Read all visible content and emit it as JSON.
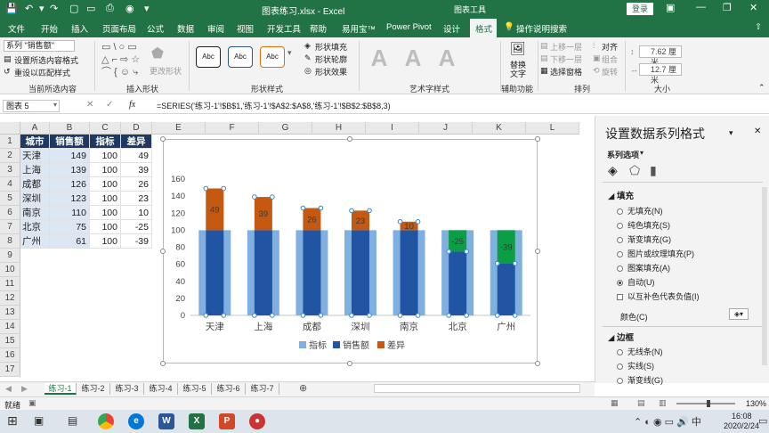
{
  "titlebar": {
    "title": "图表练习.xlsx - Excel",
    "context_tools": "图表工具",
    "login": "登录"
  },
  "tabs": [
    "文件",
    "开始",
    "插入",
    "页面布局",
    "公式",
    "数据",
    "审阅",
    "视图",
    "开发工具",
    "帮助",
    "易用宝™",
    "Power Pivot",
    "设计",
    "格式"
  ],
  "search": "操作说明搜索",
  "ribbon": {
    "current_selection": {
      "dropdown": "系列 \"销售额\"",
      "format_selection": "设置所选内容格式",
      "reset_match": "重设以匹配样式",
      "label": "当前所选内容"
    },
    "insert_shapes": {
      "change_shape": "更改形状",
      "label": "插入形状"
    },
    "shape_styles": {
      "sample": "Abc",
      "fill": "形状填充",
      "outline": "形状轮廓",
      "effects": "形状效果",
      "label": "形状样式"
    },
    "wordart": {
      "sample": "A",
      "label": "艺术字样式"
    },
    "accessibility": {
      "alt_text": "替换文字",
      "label": "辅助功能"
    },
    "arrange": {
      "bring_forward": "上移一层",
      "send_backward": "下移一层",
      "selection_pane": "选择窗格",
      "align": "对齐",
      "group": "组合",
      "rotate": "旋转",
      "label": "排列"
    },
    "size": {
      "height": "7.62 厘米",
      "width": "12.7 厘米",
      "label": "大小"
    }
  },
  "formula_bar": {
    "name_box": "图表 5",
    "fx": "fx",
    "formula": "=SERIES('练习-1'!$B$1,'练习-1'!$A$2:$A$8,'练习-1'!$B$2:$B$8,3)"
  },
  "columns": [
    "A",
    "B",
    "C",
    "D",
    "E",
    "F",
    "G",
    "H",
    "I",
    "J",
    "K",
    "L"
  ],
  "rows": [
    "1",
    "2",
    "3",
    "4",
    "5",
    "6",
    "7",
    "8",
    "9",
    "10",
    "11",
    "12",
    "13",
    "14",
    "15",
    "16",
    "17"
  ],
  "table": {
    "headers": [
      "城市",
      "销售额",
      "指标",
      "差异"
    ],
    "rows": [
      [
        "天津",
        "149",
        "100",
        "49"
      ],
      [
        "上海",
        "139",
        "100",
        "39"
      ],
      [
        "成都",
        "126",
        "100",
        "26"
      ],
      [
        "深圳",
        "123",
        "100",
        "23"
      ],
      [
        "南京",
        "110",
        "100",
        "10"
      ],
      [
        "北京",
        "75",
        "100",
        "-25"
      ],
      [
        "广州",
        "61",
        "100",
        "-39"
      ]
    ]
  },
  "chart_data": {
    "type": "bar",
    "categories": [
      "天津",
      "上海",
      "成都",
      "深圳",
      "南京",
      "北京",
      "广州"
    ],
    "series": [
      {
        "name": "指标",
        "values": [
          100,
          100,
          100,
          100,
          100,
          100,
          100
        ],
        "color": "#7fb0df"
      },
      {
        "name": "销售额",
        "values": [
          149,
          139,
          126,
          123,
          110,
          75,
          61
        ],
        "color": "#2155a3"
      },
      {
        "name": "差异",
        "values": [
          49,
          39,
          26,
          23,
          10,
          -25,
          -39
        ],
        "color_positive": "#c65911",
        "color_negative": "#0b9e45"
      }
    ],
    "ylim": [
      0,
      160
    ],
    "yticks": [
      "0",
      "20",
      "40",
      "60",
      "80",
      "100",
      "120",
      "140",
      "160"
    ],
    "grid": false,
    "legend": "bottom"
  },
  "pane": {
    "title": "设置数据系列格式",
    "subtitle": "系列选项",
    "fill_section": "填充",
    "fill_options": [
      "无填充(N)",
      "纯色填充(S)",
      "渐变填充(G)",
      "图片或纹理填充(P)",
      "图案填充(A)",
      "自动(U)"
    ],
    "invert_negative": "以互补色代表负值(I)",
    "color_label": "颜色(C)",
    "border_section": "边框",
    "border_options": [
      "无线条(N)",
      "实线(S)",
      "渐变线(G)"
    ]
  },
  "sheets": [
    "练习-1",
    "练习-2",
    "练习-3",
    "练习-4",
    "练习-5",
    "练习-6",
    "练习-7"
  ],
  "status": {
    "ready": "就绪",
    "zoom": "130%"
  },
  "taskbar": {
    "time": "16:08",
    "date": "2020/2/24"
  }
}
